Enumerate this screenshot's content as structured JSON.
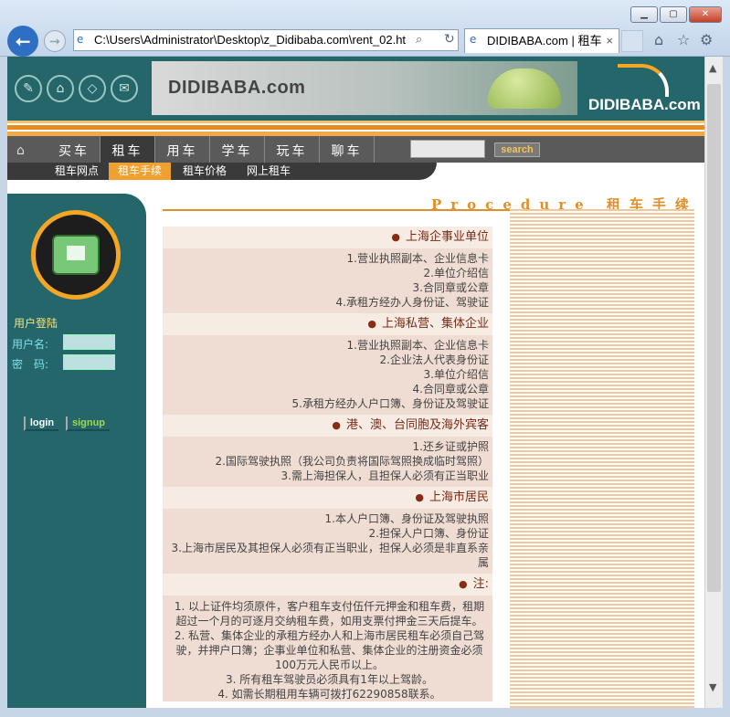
{
  "browser": {
    "address": "C:\\Users\\Administrator\\Desktop\\z_Didibaba.com\\rent_02.ht",
    "tab_title": "DIDIBABA.com | 租车",
    "tab_close": "×"
  },
  "header": {
    "banner_text": "DIDIBABA.com",
    "logo_text": "DIDIBABA.com"
  },
  "nav": {
    "items": [
      "买车",
      "租车",
      "用车",
      "学车",
      "玩车",
      "聊车"
    ],
    "active": "租车",
    "search_label": "search"
  },
  "subnav": {
    "items": [
      "租车网点",
      "租车手续",
      "租车价格",
      "网上租车"
    ],
    "active": "租车手续"
  },
  "login": {
    "title": "用户登陆",
    "username_label": "用户名:",
    "password_label": "密　码:",
    "login_button": "login",
    "signup_button": "signup"
  },
  "content": {
    "title": "Procedure 租车手续",
    "sections": [
      {
        "heading": "上海企事业单位",
        "lines": [
          "1.营业执照副本、企业信息卡",
          "2.单位介绍信",
          "3.合同章或公章",
          "4.承租方经办人身份证、驾驶证"
        ]
      },
      {
        "heading": "上海私营、集体企业",
        "lines": [
          "1.营业执照副本、企业信息卡",
          "2.企业法人代表身份证",
          "3.单位介绍信",
          "4.合同章或公章",
          "5.承租方经办人户口簿、身份证及驾驶证"
        ]
      },
      {
        "heading": "港、澳、台同胞及海外宾客",
        "lines": [
          "1.还乡证或护照",
          "2.国际驾驶执照（我公司负责将国际驾照换成临时驾照）",
          "3.需上海担保人，且担保人必须有正当职业"
        ]
      },
      {
        "heading": "上海市居民",
        "lines": [
          "1.本人户口簿、身份证及驾驶执照",
          "2.担保人户口簿、身份证",
          "3.上海市居民及其担保人必须有正当职业，担保人必须是非直系亲属"
        ]
      }
    ],
    "note": {
      "heading": "注:",
      "lines": [
        "1. 以上证件均须原件，客户租车支付伍仟元押金和租车费，租期超过一个月的可逐月交纳租车费，如用支票付押金三天后提车。",
        "2. 私营、集体企业的承租方经办人和上海市居民租车必须自己驾驶，并押户口簿；企事业单位和私营、集体企业的注册资金必须100万元人民币以上。",
        "3. 所有租车驾驶员必须具有1年以上驾龄。",
        "4. 如需长期租用车辆可拨打62290858联系。"
      ]
    }
  }
}
